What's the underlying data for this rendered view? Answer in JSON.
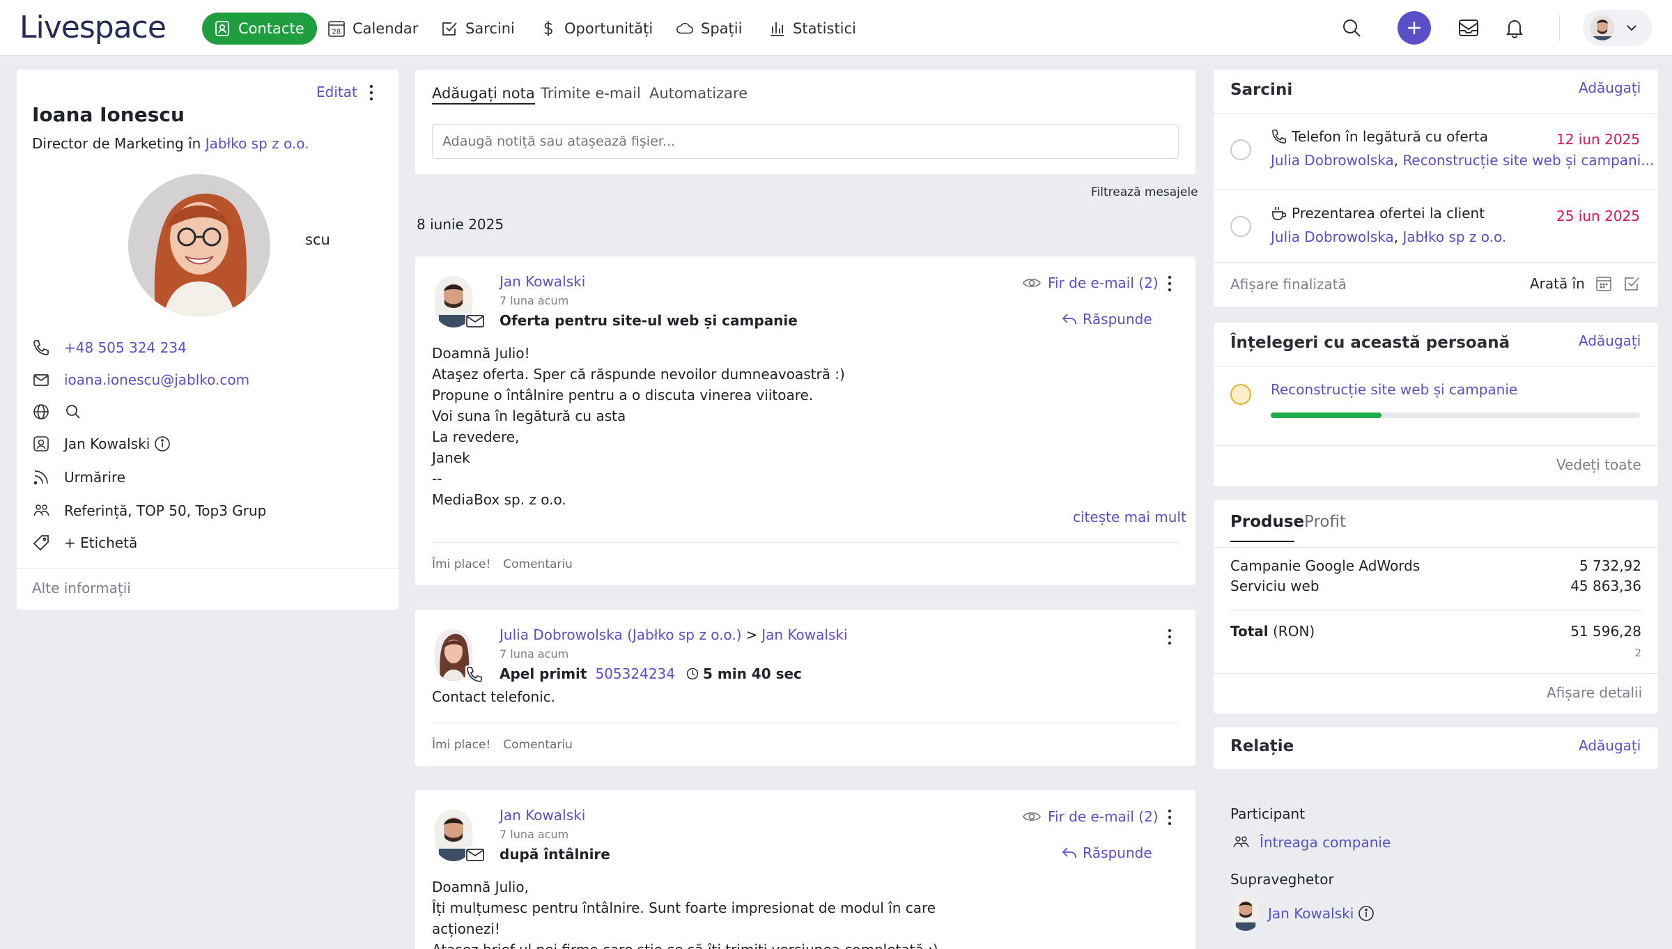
{
  "app": {
    "logo": "Livespace"
  },
  "nav": {
    "items": [
      {
        "label": "Contacte",
        "icon": "contact-icon",
        "active": true
      },
      {
        "label": "Calendar",
        "icon": "calendar-icon",
        "badge": "28"
      },
      {
        "label": "Sarcini",
        "icon": "task-check-icon"
      },
      {
        "label": "Oportunități",
        "icon": "dollar-icon"
      },
      {
        "label": "Spații",
        "icon": "cloud-icon"
      },
      {
        "label": "Statistici",
        "icon": "chart-bars-icon"
      }
    ]
  },
  "contact": {
    "edit_label": "Editat",
    "name": "Ioana Ionescu",
    "role_prefix": "Director de Marketing în",
    "company": "Jabłko sp z o.o.",
    "photo_caption": "scu",
    "phone": "+48 505 324 234",
    "email": "ioana.ionescu@jablko.com",
    "owner": "Jan Kowalski",
    "follow_label": "Urmărire",
    "groups": "Referință, TOP 50, Top3 Grup",
    "add_tag": "+ Etichetă",
    "more_info": "Alte informații"
  },
  "notes": {
    "tabs": [
      "Adăugați nota",
      "Trimite e-mail",
      "Automatizare"
    ],
    "placeholder": "Adaugă notiță sau atașează fișier...",
    "filter_label": "Filtrează mesajele"
  },
  "timeline": {
    "date": "8 iunie 2025",
    "messages": [
      {
        "author": "Jan Kowalski",
        "time": "7 luna acum",
        "subject": "Oferta pentru site-ul web și campanie",
        "thread": "Fir de e-mail (2)",
        "reply": "Răspunde",
        "body": "Doamnă Julio!\nAtaşez oferta. Sper că răspunde nevoilor dumneavoastră :)\nPropune o întâlnire pentru a o discuta vinerea viitoare.\nVoi suna în legătură cu asta\nLa revedere,\nJanek\n--\nMediaBox sp. z o.o.",
        "read_more": "citește mai mult",
        "like": "Îmi place!",
        "comment": "Comentariu"
      },
      {
        "author": "Julia Dobrowolska (Jabłko sp z o.o.)",
        "separator": ">",
        "recipient": "Jan Kowalski",
        "time": "7 luna acum",
        "call_label": "Apel primit",
        "call_number": "505324234",
        "duration": "5 min 40 sec",
        "body": "Contact telefonic.",
        "like": "Îmi place!",
        "comment": "Comentariu"
      },
      {
        "author": "Jan Kowalski",
        "time": "7 luna acum",
        "subject": "după întâlnire",
        "thread": "Fir de e-mail (2)",
        "reply": "Răspunde",
        "body": "Doamnă Julio,\nÎți mulțumesc pentru întâlnire. Sunt foarte impresionat de modul în care\nacționezi!\nAtașez brief-ul nei firme care știe ce să îți trimiti versiunea completată :)"
      }
    ]
  },
  "tasks": {
    "title": "Sarcini",
    "add": "Adăugați",
    "items": [
      {
        "icon": "phone-icon",
        "title": "Telefon în legătură cu oferta",
        "date": "12 iun 2025",
        "person": "Julia Dobrowolska",
        "related": "Reconstrucție site web și campani..."
      },
      {
        "icon": "coffee-icon",
        "title": "Prezentarea ofertei la client",
        "date": "25 iun 2025",
        "person": "Julia Dobrowolska",
        "related": "Jabłko sp z o.o."
      }
    ],
    "show_done": "Afișare finalizată",
    "show_in": "Arată în"
  },
  "deals": {
    "title": "Înțelegeri cu această persoană",
    "add": "Adăugați",
    "items": [
      {
        "name": "Reconstrucție site web și campanie",
        "progress": 0.3
      }
    ],
    "see_all": "Vedeți toate"
  },
  "products": {
    "tabs": [
      "Produse",
      "Profit"
    ],
    "items": [
      {
        "name": "Campanie Google AdWords",
        "value": "5 732,92"
      },
      {
        "name": "Serviciu web",
        "value": "45 863,36"
      }
    ],
    "total_label": "Total",
    "currency": "(RON)",
    "total": "51 596,28",
    "count": "2",
    "details": "Afișare detalii"
  },
  "relation": {
    "title": "Relație",
    "add": "Adăugați",
    "participant_label": "Participant",
    "participant": "Întreaga companie",
    "supervisor_label": "Supraveghetor",
    "supervisor": "Jan Kowalski"
  },
  "colors": {
    "accent": "#5b4fc9",
    "active_nav": "#1e9e3e",
    "date_red": "#d9164d",
    "progress": "#1fae4a"
  }
}
